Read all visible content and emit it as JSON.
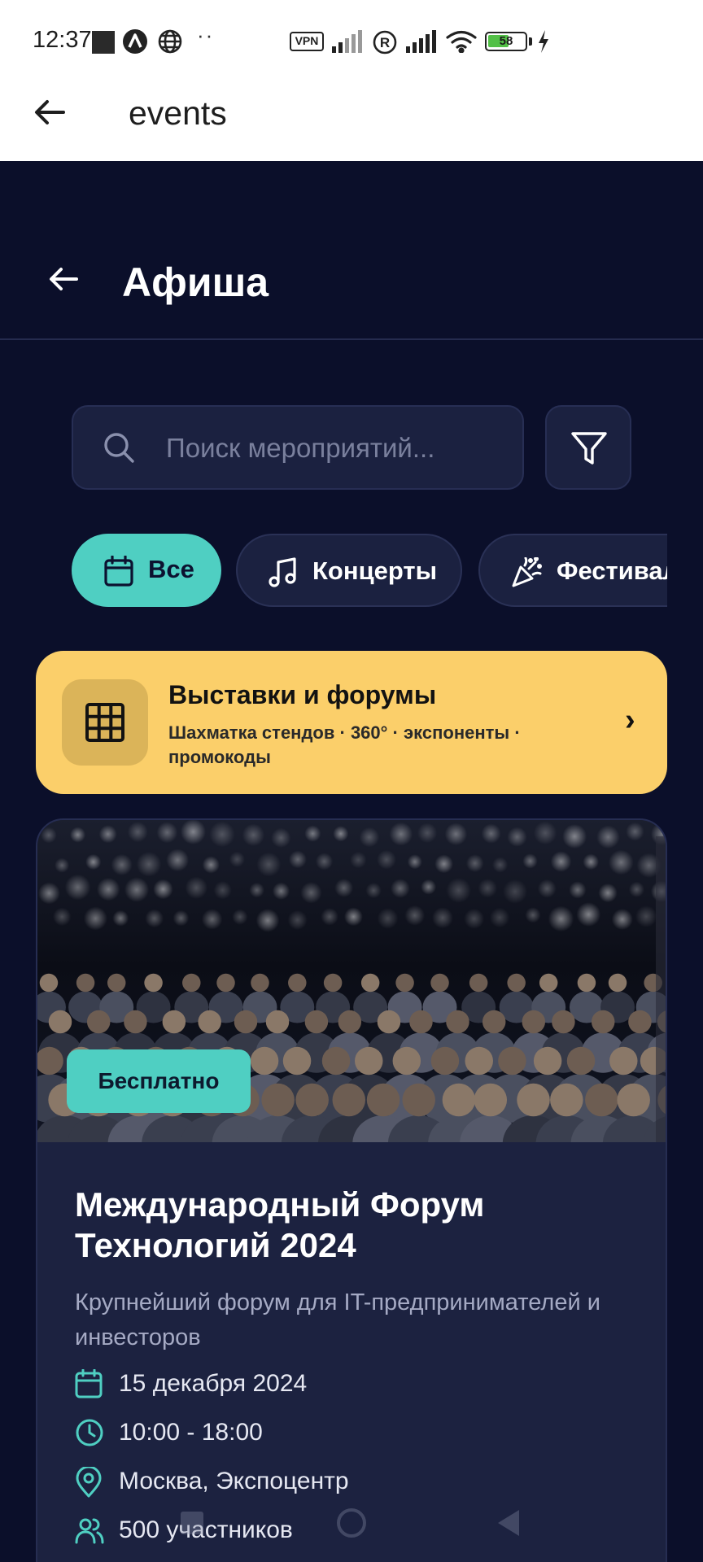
{
  "status_bar": {
    "time": "12:37",
    "vpn_label": "VPN",
    "battery_level": "58",
    "battery_fraction": 0.58,
    "icons": [
      "app-notification-icon",
      "a-logo-icon",
      "globe-icon",
      "more-dots-icon",
      "vpn-icon",
      "signal-icon",
      "registered-icon",
      "signal-icon",
      "wifi-icon",
      "battery-icon",
      "charging-icon"
    ]
  },
  "app_bar": {
    "title": "events",
    "back_icon": "arrow-left-icon"
  },
  "header": {
    "title": "Афиша",
    "back_icon": "arrow-left-icon"
  },
  "search": {
    "placeholder": "Поиск мероприятий...",
    "value": "",
    "icon": "search-icon",
    "filter_icon": "filter-icon"
  },
  "categories": [
    {
      "label": "Все",
      "icon": "calendar-icon",
      "active": true
    },
    {
      "label": "Концерты",
      "icon": "music-note-icon",
      "active": false
    },
    {
      "label": "Фестивали",
      "icon": "party-popper-icon",
      "active": false
    }
  ],
  "promo_banner": {
    "title": "Выставки и форумы",
    "subtitle": "Шахматка стендов · 360° · экспоненты · промокоды",
    "icon": "grid-icon",
    "chevron": "›"
  },
  "event_card": {
    "badge": "Бесплатно",
    "title": "Международный Форум Технологий 2024",
    "description": "Крупнейший форум для IT-предпринимателей и инвесторов",
    "date": "15 декабря 2024",
    "time": "10:00 - 18:00",
    "location": "Москва, Экспоцентр",
    "participants": "500 участников"
  },
  "colors": {
    "page_bg": "#0b0f2a",
    "card_bg": "#1c2240",
    "accent_teal": "#4fcfc2",
    "banner_yellow": "#fbcf6a",
    "text_muted": "#a5aac4"
  }
}
